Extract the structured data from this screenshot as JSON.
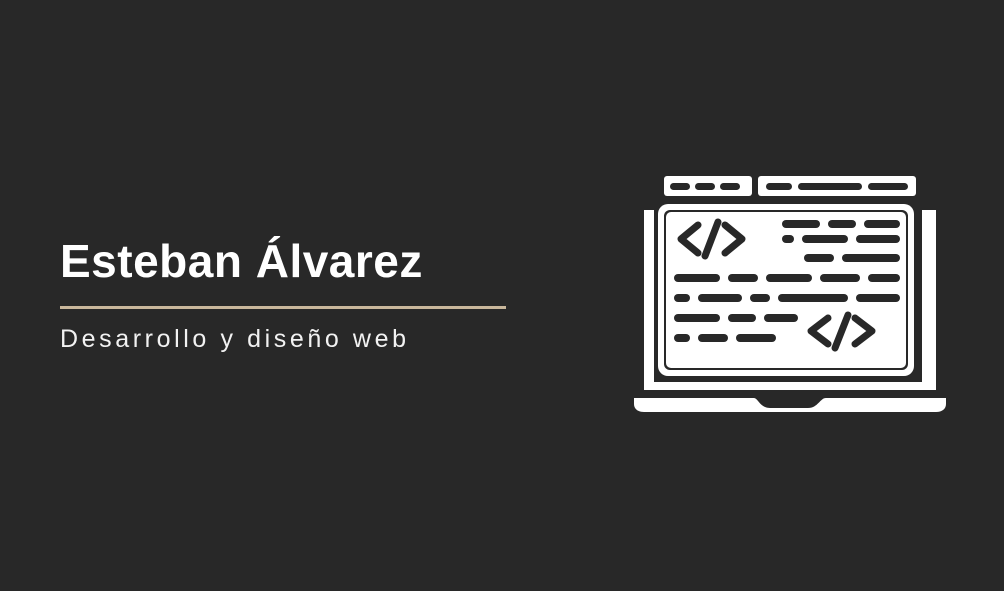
{
  "card": {
    "name": "Esteban Álvarez",
    "tagline": "Desarrollo y diseño web",
    "icon": "laptop-code-icon"
  },
  "colors": {
    "background": "#282828",
    "text": "#ffffff",
    "accent_divider": "#c9b79c"
  }
}
